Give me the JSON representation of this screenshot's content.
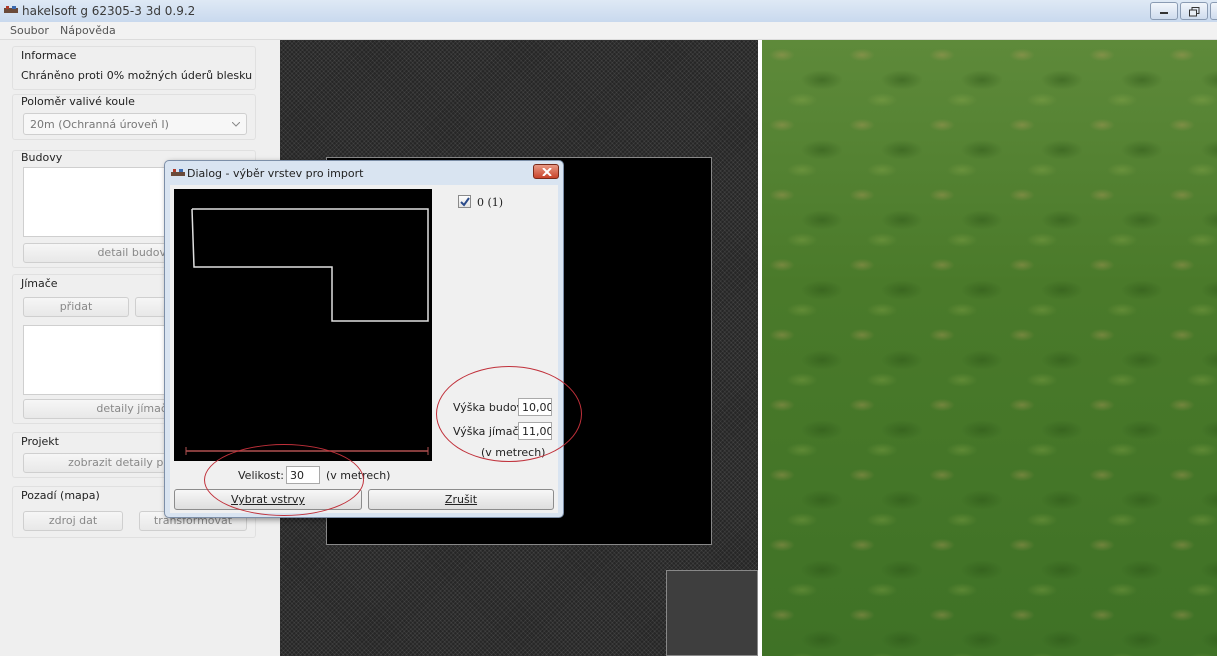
{
  "window": {
    "title": "hakelsoft g 62305-3 3d 0.9.2"
  },
  "menu": {
    "items": [
      "Soubor",
      "Nápověda"
    ]
  },
  "left_panel": {
    "info": {
      "title": "Informace",
      "text": "Chráněno proti 0% možných úderů blesku"
    },
    "radius": {
      "title": "Poloměr valivé koule",
      "selected": "20m (Ochranná úroveň I)"
    },
    "buildings": {
      "title": "Budovy",
      "detail_button": "detail budovy"
    },
    "rods": {
      "title": "Jímače",
      "add_button": "přidat",
      "detail_button": "detaily jímače"
    },
    "project": {
      "title": "Projekt",
      "details_button": "zobrazit detaily projektu"
    },
    "background": {
      "title": "Pozadí (mapa)",
      "source_button": "zdroj dat",
      "transform_button": "transformovat"
    }
  },
  "dialog": {
    "title": "Dialog - výběr vrstev pro import",
    "layer_label": "0 (1)",
    "layer_checked": true,
    "building_height_label": "Výška budov:",
    "building_height_value": "10,00",
    "rod_height_label": "Výška jímače:",
    "rod_height_value": "11,00",
    "height_units": "(v metrech)",
    "size_label": "Velikost:",
    "size_value": "30",
    "size_units": "(v metrech)",
    "select_button": "Vybrat vstrvy",
    "cancel_button": "Zrušit"
  },
  "colors": {
    "annotation": "#c0303a",
    "grass": "#4f7f2e",
    "close_button": "#c8432a"
  }
}
